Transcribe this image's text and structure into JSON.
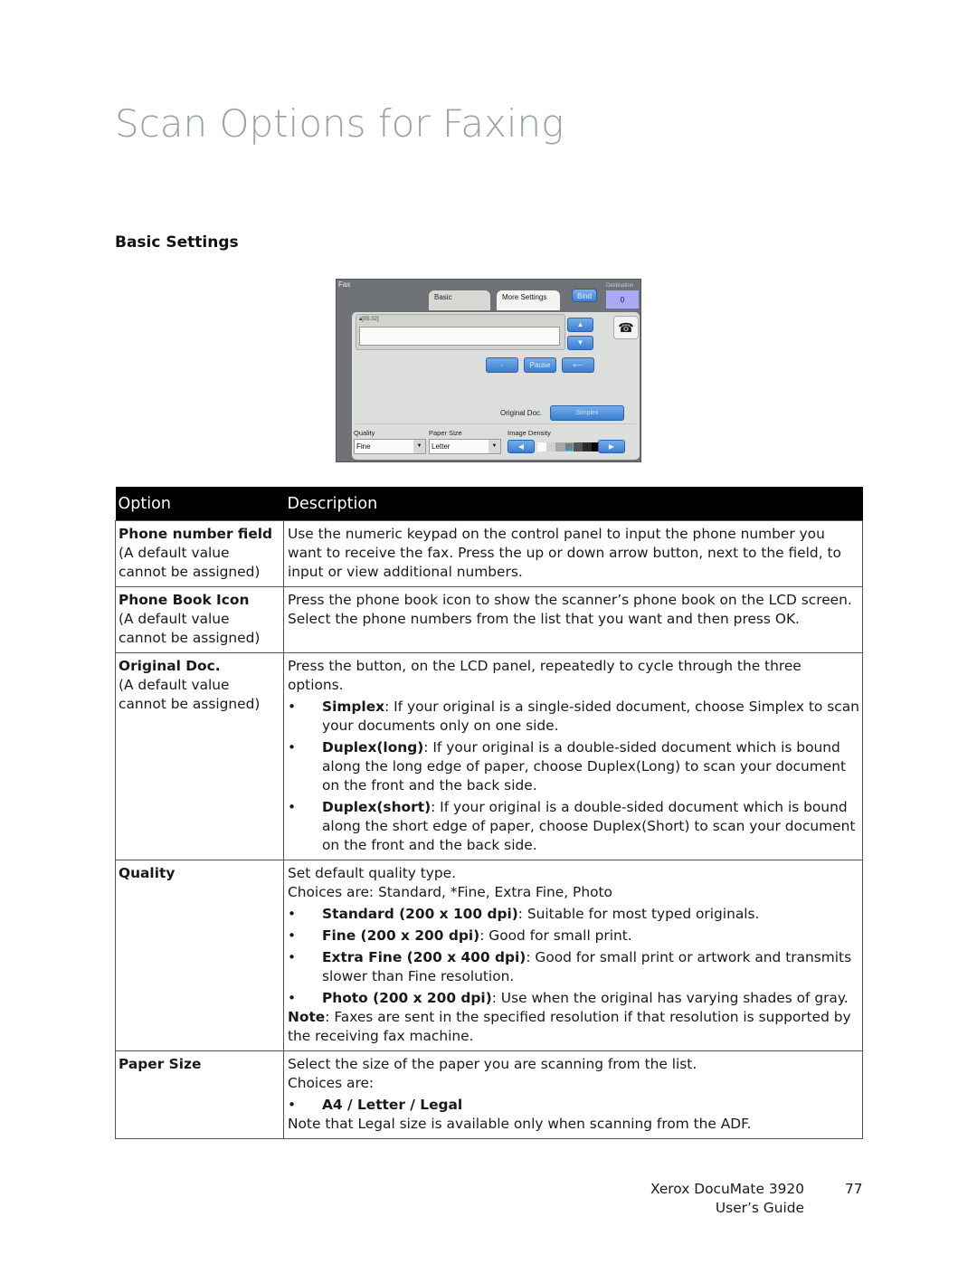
{
  "page": {
    "title": "Scan Options for Faxing",
    "section_heading": "Basic Settings"
  },
  "lcd": {
    "app_label": "Fax",
    "tabs": [
      {
        "label": "Basic"
      },
      {
        "label": "More Settings",
        "selected": true
      }
    ],
    "bind_label": "Bind",
    "destination_label": "Destination",
    "destination_count": "0",
    "time": "[05:32]",
    "phone_number_value": "",
    "up_icon": "up-arrow-icon",
    "down_icon": "down-arrow-icon",
    "phonebook_icon": "telephone-icon",
    "dash_label": "-",
    "pause_label": "Pause",
    "backspace_icon": "left-arrow-icon",
    "original_doc_label": "Original Doc.",
    "original_doc_value": "Simplex",
    "quality_label": "Quality",
    "quality_value": "Fine",
    "paper_size_label": "Paper Size",
    "paper_size_value": "Letter",
    "image_density_label": "Image Density",
    "image_density_level": 4,
    "image_density_levels": 7,
    "colors": {
      "frame": "#6f7378",
      "panel": "#dcdedb",
      "button_blue": "#3b7cd0",
      "destination_bg": "#a9aaf5"
    }
  },
  "table": {
    "headers": {
      "option": "Option",
      "description": "Description"
    },
    "rows": [
      {
        "option": "Phone number field",
        "note": "(A default value cannot be assigned)",
        "intro": "Use the numeric keypad on the control panel to input the phone number you want to receive the fax. Press the up or down arrow button, next to the field, to input or view additional numbers."
      },
      {
        "option": "Phone Book Icon",
        "note": "(A default value cannot be assigned)",
        "intro": "Press the phone book icon to show the scanner’s phone book on the LCD screen. Select the phone numbers from the list that you want and then press OK."
      },
      {
        "option": "Original Doc.",
        "note": "(A default value cannot be assigned)",
        "intro": "Press the button, on the LCD panel, repeatedly to cycle through the three options.",
        "bullets": [
          {
            "term": "Simplex",
            "text": ": If your original is a single-sided document, choose Simplex to scan your documents only on one side."
          },
          {
            "term": "Duplex(long)",
            "text": ": If your original is a double-sided document which is bound along the long edge of paper, choose Duplex(Long) to scan your document on the front and the back side."
          },
          {
            "term": "Duplex(short)",
            "text": ": If your original is a double-sided document which is bound along the short edge of paper, choose Duplex(Short) to scan your document on the front and the back side."
          }
        ]
      },
      {
        "option": "Quality",
        "intro": "Set default quality type.",
        "intro2": "Choices are: Standard, *Fine, Extra Fine, Photo",
        "bullets": [
          {
            "term": "Standard (200 x 100 dpi)",
            "text": ": Suitable for most typed originals."
          },
          {
            "term": "Fine (200 x 200 dpi)",
            "text": ": Good for small print."
          },
          {
            "term": "Extra Fine (200 x 400 dpi)",
            "text": ": Good for small print or artwork and transmits slower than Fine resolution."
          },
          {
            "term": "Photo (200 x 200 dpi)",
            "text": ": Use when the original has varying shades of gray."
          }
        ],
        "note_label": "Note",
        "note_text": ": Faxes are sent in the specified resolution if that resolution is supported by the receiving fax machine."
      },
      {
        "option": "Paper Size",
        "intro": "Select the size of the paper you are scanning from the list.",
        "intro2": "Choices are:",
        "bullets": [
          {
            "term": "A4 / Letter / Legal",
            "text": ""
          }
        ],
        "outro": "Note that Legal size is available only when scanning from the ADF."
      }
    ],
    "bullet_char": "•"
  },
  "footer": {
    "product": "Xerox DocuMate 3920",
    "guide": "User’s Guide",
    "page_number": "77"
  }
}
